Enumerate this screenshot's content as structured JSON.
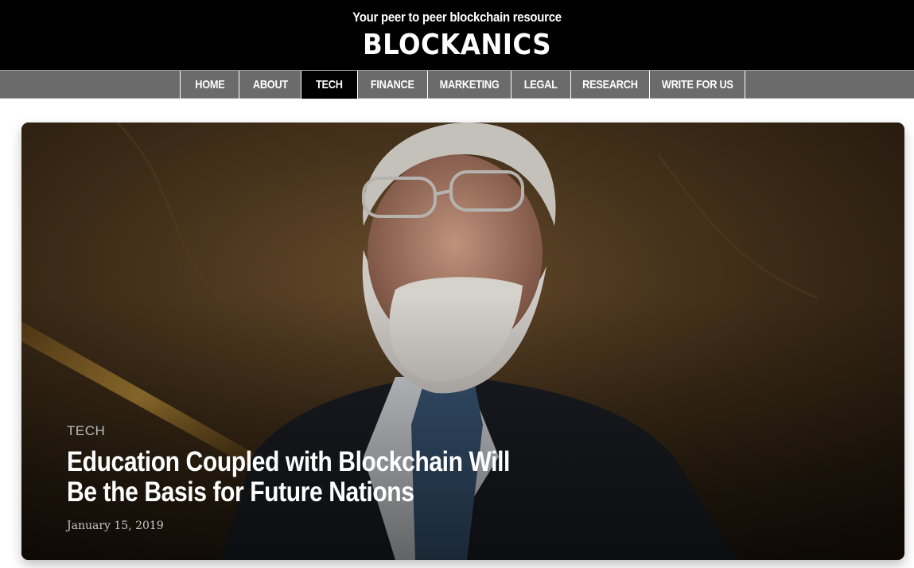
{
  "header": {
    "tagline": "Your peer to peer blockchain resource",
    "logo_text": "BLOCKANICS"
  },
  "nav": {
    "items": [
      {
        "label": "HOME",
        "active": false
      },
      {
        "label": "ABOUT",
        "active": false
      },
      {
        "label": "TECH",
        "active": true
      },
      {
        "label": "FINANCE",
        "active": false
      },
      {
        "label": "MARKETING",
        "active": false
      },
      {
        "label": "LEGAL",
        "active": false
      },
      {
        "label": "RESEARCH",
        "active": false
      },
      {
        "label": "WRITE FOR US",
        "active": false
      }
    ]
  },
  "hero": {
    "category": "TECH",
    "title": "Education Coupled with Blockchain Will Be the Basis for Future Nations",
    "date": "January 15, 2019"
  },
  "colors": {
    "header_bg": "#000000",
    "nav_bg": "#6b6b6b",
    "nav_active_bg": "#000000",
    "text_white": "#ffffff"
  }
}
